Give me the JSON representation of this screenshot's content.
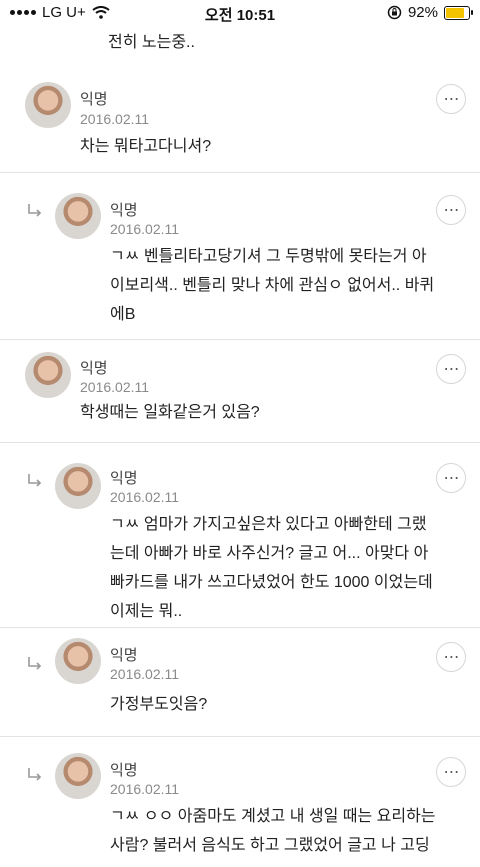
{
  "status_bar": {
    "carrier": "LG U+",
    "time": "오전 10:51",
    "battery": "92%",
    "battery_level": 0.92
  },
  "previous_comment_tail": "전히 노는중..",
  "comments": [
    {
      "author": "익명",
      "date": "2016.02.11",
      "is_reply": false,
      "lines": [
        "차는 뭐타고다니셔?"
      ]
    },
    {
      "author": "익명",
      "date": "2016.02.11",
      "is_reply": true,
      "lines": [
        "ㄱㅆ 벤틀리타고당기셔 그 두명밖에 못타는거 아",
        "이보리색.. 벤틀리 맞나 차에 관심ㅇ 없어서.. 바퀴",
        "에B"
      ]
    },
    {
      "author": "익명",
      "date": "2016.02.11",
      "is_reply": false,
      "lines": [
        "학생때는 일화같은거 있음?"
      ]
    },
    {
      "author": "익명",
      "date": "2016.02.11",
      "is_reply": true,
      "lines": [
        "ㄱㅆ 엄마가 가지고싶은차 있다고 아빠한테 그랬",
        "는데 아빠가 바로 사주신거? 글고 어... 아맞다 아",
        "빠카드를 내가 쓰고다녔었어 한도 1000 이었는데",
        "이제는 뭐.."
      ]
    },
    {
      "author": "익명",
      "date": "2016.02.11",
      "is_reply": true,
      "lines": [
        "가정부도잇음?"
      ]
    },
    {
      "author": "익명",
      "date": "2016.02.11",
      "is_reply": true,
      "lines": [
        "ㄱㅆ ㅇㅇ 아줌마도 계셨고 내 생일 때는 요리하는",
        "사람? 불러서 음식도 하고 그랬었어 글고 나 고딩"
      ]
    }
  ],
  "more_icon_glyph": "⋯"
}
